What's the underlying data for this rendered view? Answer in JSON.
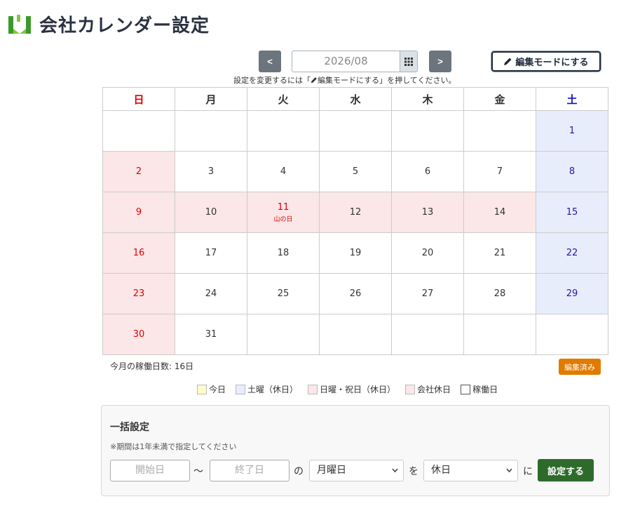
{
  "header": {
    "title": "会社カレンダー設定"
  },
  "nav": {
    "prev_label": "<",
    "next_label": ">",
    "month_value": "2026/08",
    "edit_mode_label": "編集モードにする",
    "hint_prefix": "設定を変更するには「",
    "hint_link": "編集モードにする",
    "hint_suffix": "」を押してください。"
  },
  "calendar": {
    "weekdays": [
      "日",
      "月",
      "火",
      "水",
      "木",
      "金",
      "土"
    ],
    "weeks": [
      [
        {
          "d": ""
        },
        {
          "d": ""
        },
        {
          "d": ""
        },
        {
          "d": ""
        },
        {
          "d": ""
        },
        {
          "d": ""
        },
        {
          "d": "1",
          "t": "sat"
        }
      ],
      [
        {
          "d": "2",
          "t": "sun"
        },
        {
          "d": "3"
        },
        {
          "d": "4"
        },
        {
          "d": "5"
        },
        {
          "d": "6"
        },
        {
          "d": "7"
        },
        {
          "d": "8",
          "t": "sat"
        }
      ],
      [
        {
          "d": "9",
          "t": "sun"
        },
        {
          "d": "10",
          "t": "company"
        },
        {
          "d": "11",
          "t": "holiday",
          "note": "山の日"
        },
        {
          "d": "12",
          "t": "company"
        },
        {
          "d": "13",
          "t": "company"
        },
        {
          "d": "14",
          "t": "company"
        },
        {
          "d": "15",
          "t": "sat"
        }
      ],
      [
        {
          "d": "16",
          "t": "sun"
        },
        {
          "d": "17"
        },
        {
          "d": "18"
        },
        {
          "d": "19"
        },
        {
          "d": "20"
        },
        {
          "d": "21"
        },
        {
          "d": "22",
          "t": "sat"
        }
      ],
      [
        {
          "d": "23",
          "t": "sun"
        },
        {
          "d": "24"
        },
        {
          "d": "25"
        },
        {
          "d": "26"
        },
        {
          "d": "27"
        },
        {
          "d": "28"
        },
        {
          "d": "29",
          "t": "sat"
        }
      ],
      [
        {
          "d": "30",
          "t": "sun"
        },
        {
          "d": "31"
        },
        {
          "d": ""
        },
        {
          "d": ""
        },
        {
          "d": ""
        },
        {
          "d": ""
        },
        {
          "d": ""
        }
      ]
    ]
  },
  "summary": {
    "working_days": "今月の稼働日数: 16日",
    "edited_badge": "編集済み"
  },
  "legend": [
    {
      "label": "今日",
      "color": "#fdfbc8"
    },
    {
      "label": "土曜（休日）",
      "color": "#e8edfb"
    },
    {
      "label": "日曜・祝日（休日）",
      "color": "#fbe6e8"
    },
    {
      "label": "会社休日",
      "color": "#fbe6e8"
    },
    {
      "label": "稼働日",
      "color": "#ffffff"
    }
  ],
  "bulk": {
    "title": "一括設定",
    "note": "※期間は1年未満で指定してください",
    "start_placeholder": "開始日",
    "tilde": "〜",
    "end_placeholder": "終了日",
    "no": "の",
    "weekday_value": "月曜日",
    "wo": "を",
    "type_value": "休日",
    "ni": "に",
    "apply_label": "設定する"
  },
  "colors": {
    "apply_green": "#2e6b2b",
    "badge_orange": "#e07b00",
    "nav_gray": "#6c757d"
  }
}
